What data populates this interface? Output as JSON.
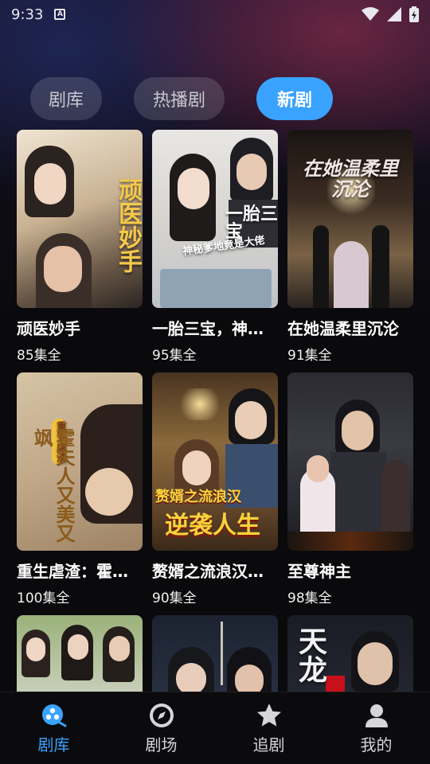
{
  "status_bar": {
    "time": "9:33",
    "notification_glyph": "A"
  },
  "tabs": [
    {
      "label": "剧库",
      "active": false
    },
    {
      "label": "热播剧",
      "active": false
    },
    {
      "label": "新剧",
      "active": true
    }
  ],
  "dramas": [
    {
      "title": "顽医妙手",
      "episodes": "85集全",
      "poster_text": "顽医妙手"
    },
    {
      "title": "一胎三宝，神秘爹地竟是大佬",
      "episodes": "95集全",
      "poster_text": "一胎三宝",
      "poster_subtext": "神秘爹地竟是大佬"
    },
    {
      "title": "在她温柔里沉沦",
      "episodes": "91集全",
      "poster_text": "在她温柔里沉沦"
    },
    {
      "title": "重生虐渣：霍夫人又美又飒",
      "episodes": "100集全",
      "poster_text": "霍夫人又美又飒",
      "poster_tag": "重生虐渣"
    },
    {
      "title": "赘婿之流浪汉逆袭人生",
      "episodes": "90集全",
      "poster_text": "赘婿之流浪汉",
      "poster_subtext": "逆袭人生"
    },
    {
      "title": "至尊神主",
      "episodes": "98集全"
    },
    {
      "title": "",
      "episodes": ""
    },
    {
      "title": "",
      "episodes": ""
    },
    {
      "title": "",
      "episodes": "",
      "poster_text": "天龙"
    }
  ],
  "bottom_nav": [
    {
      "label": "剧库",
      "icon": "library-icon",
      "active": true
    },
    {
      "label": "剧场",
      "icon": "compass-icon",
      "active": false
    },
    {
      "label": "追剧",
      "icon": "star-icon",
      "active": false
    },
    {
      "label": "我的",
      "icon": "profile-icon",
      "active": false
    }
  ],
  "colors": {
    "accent": "#3aa2ff",
    "tab_inactive_bg": "#2a2a33",
    "background": "#0a0a0c"
  }
}
